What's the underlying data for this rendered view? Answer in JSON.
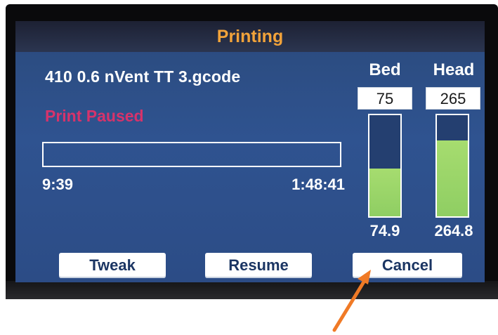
{
  "screen": {
    "title": "Printing",
    "filename": "410 0.6 nVent TT 3.gcode",
    "status": "Print Paused",
    "progress": {
      "fraction": 0.0,
      "elapsed": "9:39",
      "remaining": "1:48:41"
    }
  },
  "temperatures": {
    "bed": {
      "label": "Bed",
      "target": "75",
      "current": "74.9",
      "fill_fraction": 0.47
    },
    "head": {
      "label": "Head",
      "target": "265",
      "current": "264.8",
      "fill_fraction": 0.75
    }
  },
  "buttons": {
    "tweak": "Tweak",
    "resume": "Resume",
    "cancel": "Cancel"
  },
  "colors": {
    "title": "#f2a33a",
    "status": "#d6336b",
    "gauge_fill": "#9ccf6a",
    "screen_bg": "#2f5390",
    "annotation_arrow": "#f07a26"
  },
  "icons": {
    "annotation": "arrow-pointing-to-cancel"
  }
}
